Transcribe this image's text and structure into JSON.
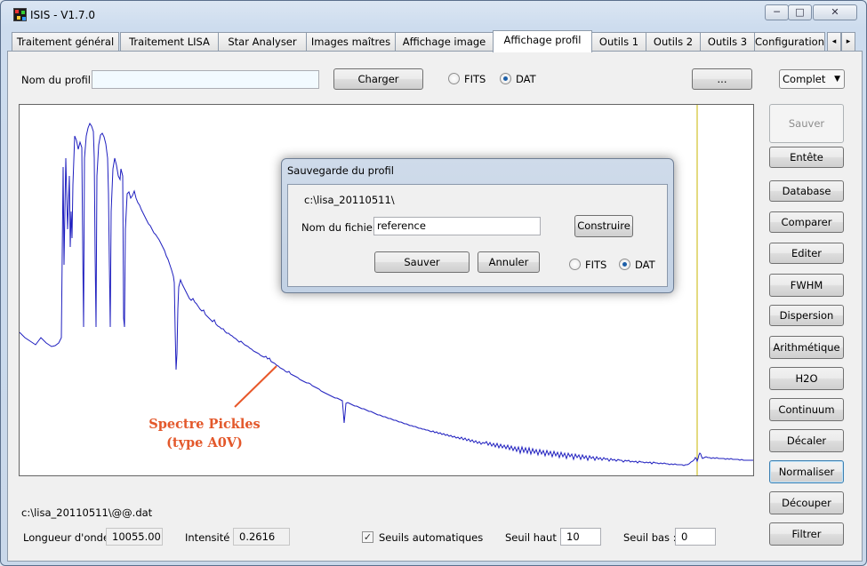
{
  "window": {
    "title": "ISIS - V1.7.0",
    "controls": [
      "minimize",
      "maximize",
      "close"
    ]
  },
  "tabs": [
    {
      "label": "Traitement général"
    },
    {
      "label": "Traitement LISA"
    },
    {
      "label": "Star Analyser"
    },
    {
      "label": "Images maîtres"
    },
    {
      "label": "Affichage image"
    },
    {
      "label": "Affichage profil",
      "active": true
    },
    {
      "label": "Outils 1"
    },
    {
      "label": "Outils 2"
    },
    {
      "label": "Outils 3"
    },
    {
      "label": "Configuration"
    }
  ],
  "tab_scroll": {
    "left": "◂",
    "right": "▸"
  },
  "toolbar": {
    "profile_name_label": "Nom du profil :",
    "profile_name_value": "",
    "load_button": "Charger",
    "format_options": [
      {
        "label": "FITS",
        "selected": false
      },
      {
        "label": "DAT",
        "selected": true
      }
    ],
    "browse_button": "...",
    "view_select": "Complet"
  },
  "side_buttons": [
    {
      "label": "Sauver",
      "enabled": false
    },
    {
      "label": "Entête"
    },
    {
      "label": "Database"
    },
    {
      "label": "Comparer"
    },
    {
      "label": "Editer"
    },
    {
      "label": "FWHM"
    },
    {
      "label": "Dispersion"
    },
    {
      "label": "Arithmétique"
    },
    {
      "label": "H2O"
    },
    {
      "label": "Continuum"
    },
    {
      "label": "Décaler"
    },
    {
      "label": "Normaliser",
      "focused": true
    },
    {
      "label": "Découper"
    },
    {
      "label": "Filtrer"
    }
  ],
  "dialog": {
    "title": "Sauvegarde du profil",
    "path": "c:\\lisa_20110511\\",
    "filename_label": "Nom du fichier :",
    "filename_value": "reference",
    "build_button": "Construire",
    "save_button": "Sauver",
    "cancel_button": "Annuler",
    "format_options": [
      {
        "label": "FITS",
        "selected": false
      },
      {
        "label": "DAT",
        "selected": true
      }
    ]
  },
  "annotation": {
    "line1": "Spectre Pickles",
    "line2": "(type A0V)",
    "color": "#e8582a"
  },
  "status": {
    "file_path": "c:\\lisa_20110511\\@@.dat",
    "wavelength_label": "Longueur d'onde :",
    "wavelength_value": "10055.00",
    "intensity_label": "Intensité :",
    "intensity_value": "0.2616",
    "auto_thresholds_label": "Seuils automatiques",
    "auto_thresholds_checked": true,
    "high_threshold_label": "Seuil haut :",
    "high_threshold_value": "10",
    "low_threshold_label": "Seuil bas :",
    "low_threshold_value": "0"
  },
  "plot": {
    "line_color": "#1f1fbf",
    "cursor_color": "#c8b400"
  }
}
